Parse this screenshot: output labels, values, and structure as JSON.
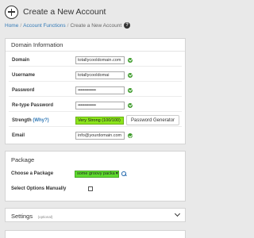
{
  "page": {
    "title": "Create a New Account",
    "breadcrumb": [
      "Home",
      "Account Functions",
      "Create a New Account"
    ],
    "breadcrumb_sep": "/"
  },
  "domain_info": {
    "heading": "Domain Information",
    "domain_label": "Domain",
    "domain_value": "totallycooldomain.com",
    "username_label": "Username",
    "username_value": "totallycooldomai",
    "password_label": "Password",
    "password_value": "••••••••••••••",
    "retype_label": "Re-type Password",
    "retype_value": "••••••••••••••",
    "strength_label": "Strength",
    "strength_why": "(Why?)",
    "strength_value": "Very Strong (100/100)",
    "generator_label": "Password Generator",
    "email_label": "Email",
    "email_value": "info@yourdomain.com"
  },
  "package": {
    "heading": "Package",
    "choose_label": "Choose a Package",
    "choose_value": "some groovy packa",
    "manual_label": "Select Options Manually",
    "manual_checked": false
  },
  "settings": {
    "heading": "Settings",
    "optional": "(optional)"
  },
  "colors": {
    "strength_bg": "#8be41b",
    "select_bg": "#5edb2e",
    "ok": "#3c9b2a",
    "link": "#337ab7"
  }
}
